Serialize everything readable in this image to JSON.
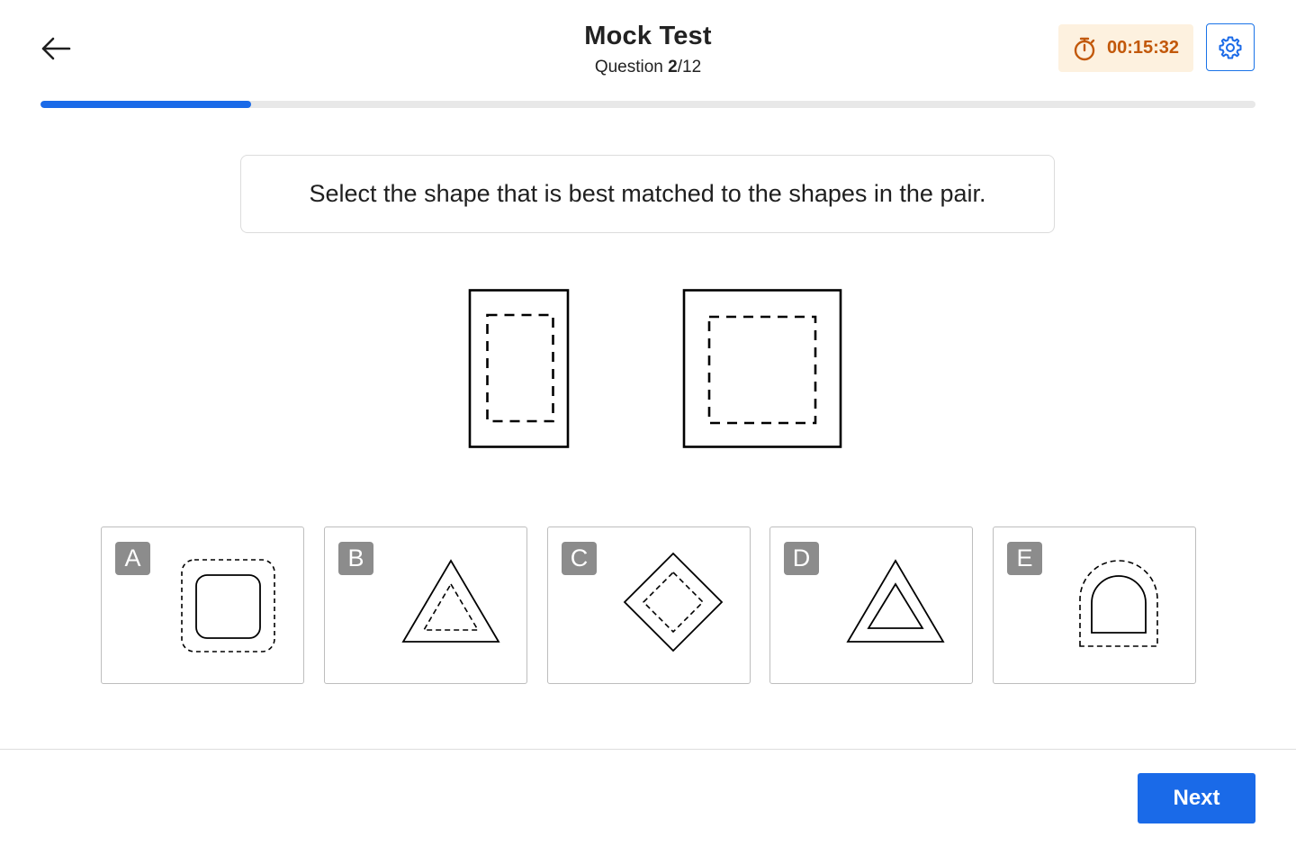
{
  "header": {
    "title": "Mock Test",
    "question_prefix": "Question ",
    "question_current": "2",
    "question_total": "/12",
    "timer": "00:15:32"
  },
  "progress": {
    "fraction": 0.1733
  },
  "question": {
    "text": "Select the shape that is best matched to the shapes in the pair."
  },
  "options": [
    {
      "letter": "A",
      "icon": "dashed-rounded-square-around-rounded-square"
    },
    {
      "letter": "B",
      "icon": "dashed-triangle-inside-triangle"
    },
    {
      "letter": "C",
      "icon": "dashed-diamond-inside-diamond"
    },
    {
      "letter": "D",
      "icon": "triangle-inside-triangle"
    },
    {
      "letter": "E",
      "icon": "dashed-arch-around-arch"
    }
  ],
  "footer": {
    "next_label": "Next"
  },
  "colors": {
    "accent": "#1a6ae8",
    "timer_text": "#c2580a",
    "timer_bg": "#fdf1df",
    "letter_badge": "#8c8c8c"
  }
}
